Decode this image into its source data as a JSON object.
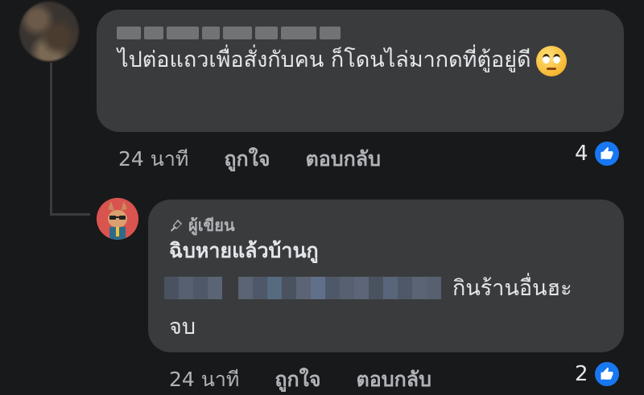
{
  "comment": {
    "text": "ไปต่อแถวเพื่อสั่งกับคน ก็โดนไล่มากดที่ตู้อยู่ดี",
    "emoji_name": "face-with-rolling-eyes",
    "time": "24 นาที",
    "like_label": "ถูกใจ",
    "reply_label": "ตอบกลับ",
    "like_count": "4"
  },
  "reply": {
    "badge": "ผู้เขียน",
    "name": "ฉิบหายแล้วบ้านกู",
    "text_visible_end": "กินร้านอื่นฮะ",
    "text_second_line": "จบ",
    "time": "24 นาที",
    "like_label": "ถูกใจ",
    "reply_label": "ตอบกลับ",
    "like_count": "2"
  },
  "colors": {
    "background": "#18191a",
    "bubble": "#3a3b3c",
    "like_blue": "#1877f2",
    "meta_text": "#b0b3b8"
  }
}
